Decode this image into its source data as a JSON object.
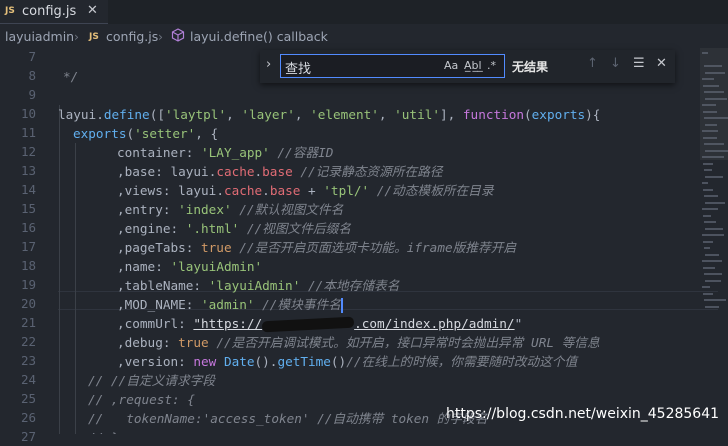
{
  "tab": {
    "icon_text": "JS",
    "name": "config.js",
    "close": "✕"
  },
  "breadcrumb": {
    "root": "layuiadmin",
    "sep": "›",
    "file_icon": "JS",
    "file": "config.js",
    "symbol": "layui.define() callback"
  },
  "find": {
    "query": "查找",
    "case_label": "Aa",
    "word_label": "A̲b̲l̲",
    "regex_label": ".*",
    "status": "无结果"
  },
  "watermark": "https://blog.csdn.net/weixin_45285641",
  "code": {
    "l7": "*/",
    "l10": [
      "layui",
      ".",
      "define",
      "([",
      "'laytpl'",
      ", ",
      "'layer'",
      ", ",
      "'element'",
      ", ",
      "'util'",
      "], ",
      "function",
      "(",
      "exports",
      "){"
    ],
    "l11": [
      "exports",
      "(",
      "'setter'",
      ", {"
    ],
    "l12": [
      "container",
      ": ",
      "'LAY_app'",
      " //容器ID"
    ],
    "l13": [
      ",base",
      ": ",
      "layui",
      ".",
      "cache",
      ".",
      "base",
      " //记录静态资源所在路径"
    ],
    "l14": [
      ",views",
      ": ",
      "layui",
      ".",
      "cache",
      ".",
      "base",
      " + ",
      "'tpl/'",
      " //动态模板所在目录"
    ],
    "l15": [
      ",entry",
      ": ",
      "'index'",
      " //默认视图文件名"
    ],
    "l16": [
      ",engine",
      ": ",
      "'.html'",
      " //视图文件后缀名"
    ],
    "l17": [
      ",pageTabs",
      ": ",
      "true",
      " //是否开启页面选项卡功能。iframe版推荐开启"
    ],
    "l18": [
      ",name",
      ": ",
      "'layuiAdmin'"
    ],
    "l19": [
      ",tableName",
      ": ",
      "'layuiAdmin'",
      " //本地存储表名"
    ],
    "l20": [
      ",MOD_NAME",
      ": ",
      "'admin'",
      " //模块事件名"
    ],
    "l21": [
      ",commUrl",
      ": ",
      "\"https://",
      ".com/index.php/admin/",
      "\""
    ],
    "l22": [
      ",debug",
      ": ",
      "true",
      " //是否开启调试模式。如开启，接口异常时会抛出异常 URL 等信息"
    ],
    "l23": [
      ",version",
      ": ",
      "new ",
      "Date",
      "().",
      "getTime",
      "()",
      "//在线上的时候，你需要随时改动这个值"
    ],
    "l24": "// //自定义请求字段",
    "l25": "// ,request: {",
    "l26": "//   tokenName:'access_token' //自动携带 token 的字段名",
    "l27": "// },"
  },
  "line_numbers": [
    "7",
    "8",
    "9",
    "10",
    "11",
    "12",
    "13",
    "14",
    "15",
    "16",
    "17",
    "18",
    "19",
    "20",
    "21",
    "22",
    "23",
    "24",
    "25",
    "26",
    "27"
  ]
}
